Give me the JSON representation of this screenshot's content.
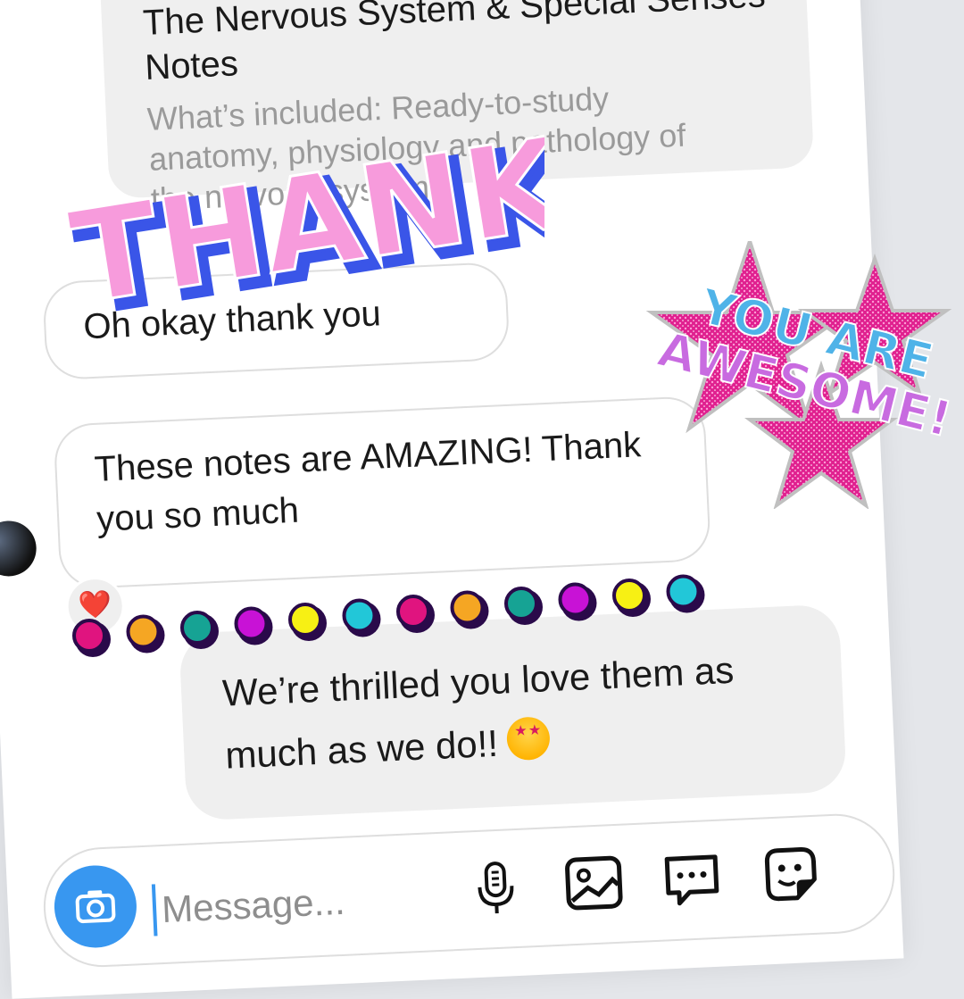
{
  "shared_post": {
    "title": "The Nervous System & Special Senses Notes",
    "description": "What’s included: Ready-to-study anatomy, physiology and pathology of the nervous system..."
  },
  "messages": [
    {
      "id": "m1",
      "from": "them",
      "text": "Oh okay thank you"
    },
    {
      "id": "m2",
      "from": "them",
      "text": "These notes are AMAZING! Thank you so much",
      "reaction": "❤️"
    },
    {
      "id": "m3",
      "from": "me",
      "text": "We’re thrilled you love them as much as we do!!",
      "emoji": "star-struck-emoji"
    }
  ],
  "composer": {
    "placeholder": "Message...",
    "icons": [
      "camera-icon",
      "microphone-icon",
      "gallery-icon",
      "chat-bubble-icon",
      "sticker-icon"
    ]
  },
  "stickers": {
    "thanks": "THANK'S!",
    "awesome_line1": "YOU ARE",
    "awesome_line2": "AWESOME!"
  },
  "colors": {
    "dots": [
      "#e0147f",
      "#f5a623",
      "#16a394",
      "#c812d6",
      "#f7f014",
      "#22c7d8",
      "#e0147f",
      "#f5a623",
      "#16a394",
      "#c812d6",
      "#f7f014",
      "#22c7d8"
    ],
    "accent": "#3897f0",
    "thanks_pink": "#f79bdc",
    "star_pink": "#e0208f"
  }
}
